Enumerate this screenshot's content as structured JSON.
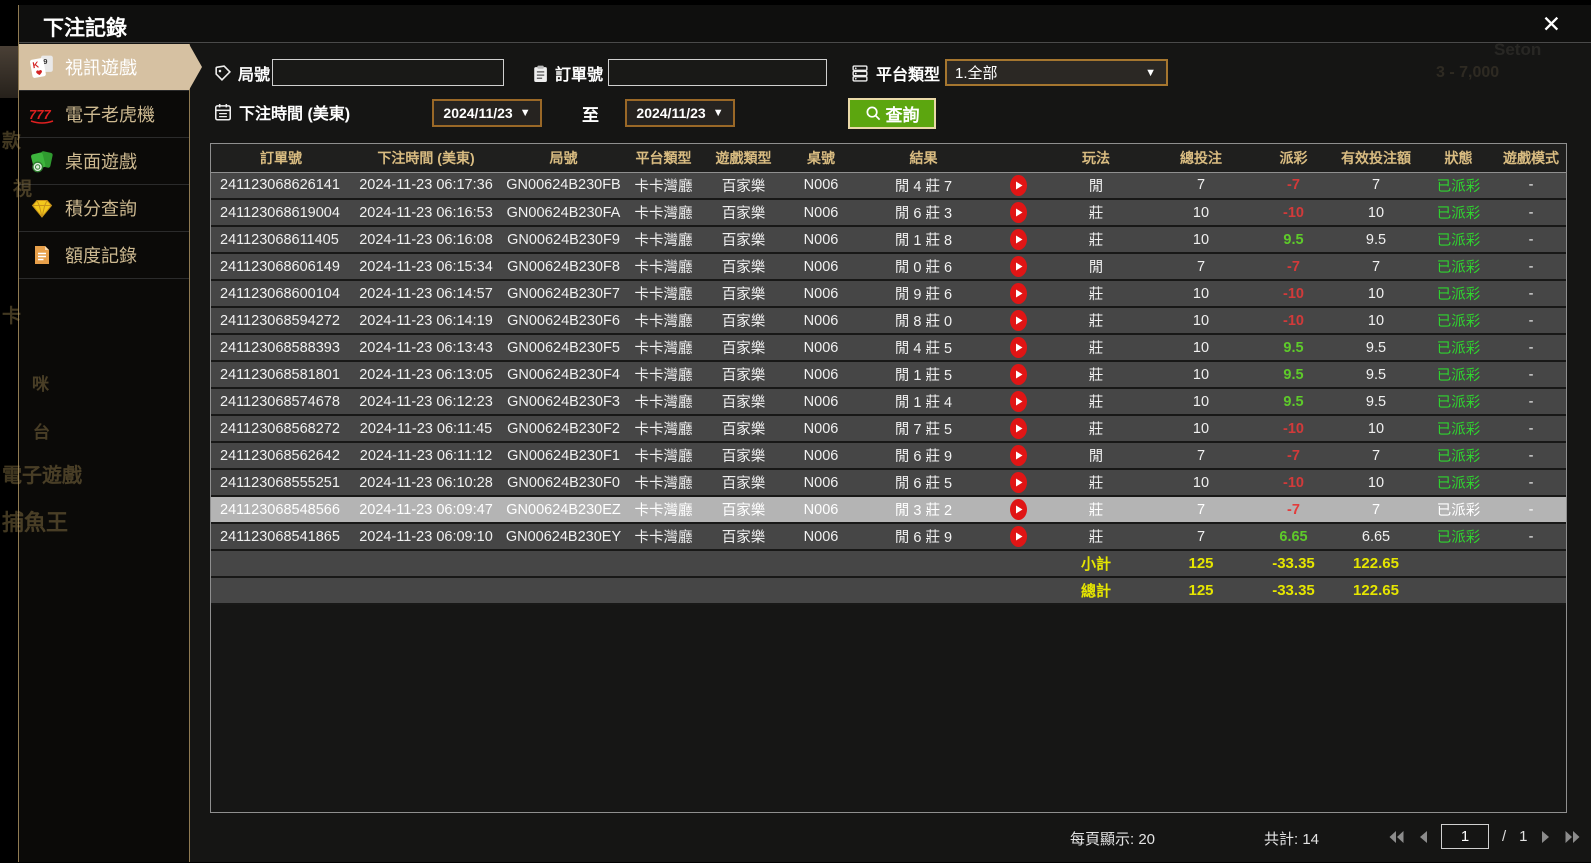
{
  "window": {
    "title": "下注記錄",
    "close_icon": "✕"
  },
  "background": {
    "fragments": {
      "f1": "款",
      "f2": "視",
      "f3": "卡",
      "f4": "咪",
      "f5": "台",
      "f6": "電子遊戲",
      "f7": "捕魚王",
      "f8": "Seton",
      "f9": "3 - 7,000"
    }
  },
  "sidebar": {
    "items": [
      {
        "label": "視訊遊戲",
        "icon": "playing-cards-icon",
        "active": true
      },
      {
        "label": "電子老虎機",
        "icon": "slot-777-icon",
        "active": false
      },
      {
        "label": "桌面遊戲",
        "icon": "table-games-icon",
        "active": false
      },
      {
        "label": "積分查詢",
        "icon": "diamond-icon",
        "active": false
      },
      {
        "label": "額度記錄",
        "icon": "document-icon",
        "active": false
      }
    ]
  },
  "filters": {
    "round_label": "局號",
    "round_value": "",
    "order_label": "訂單號",
    "order_value": "",
    "platform_label": "平台類型",
    "platform_value": "1.全部",
    "time_label": "下注時間 (美東)",
    "date_from": "2024/11/23",
    "range_to_label": "至",
    "date_to": "2024/11/23",
    "search_label": "查詢"
  },
  "table": {
    "headers": [
      "訂單號",
      "下注時間 (美東)",
      "局號",
      "平台類型",
      "遊戲類型",
      "桌號",
      "結果",
      "",
      "玩法",
      "總投注",
      "派彩",
      "有效投注額",
      "狀態",
      "遊戲模式"
    ],
    "rows": [
      {
        "order": "241123068626141",
        "time": "2024-11-23 06:17:36",
        "round": "GN00624B230FB",
        "platform": "卡卡灣廳",
        "game": "百家樂",
        "table_no": "N006",
        "result": "閒 4 莊 7",
        "play": "閒",
        "bet": "7",
        "payout": "-7",
        "valid": "7",
        "status": "已派彩",
        "mode": "-",
        "highlighted": false
      },
      {
        "order": "241123068619004",
        "time": "2024-11-23 06:16:53",
        "round": "GN00624B230FA",
        "platform": "卡卡灣廳",
        "game": "百家樂",
        "table_no": "N006",
        "result": "閒 6 莊 3",
        "play": "莊",
        "bet": "10",
        "payout": "-10",
        "valid": "10",
        "status": "已派彩",
        "mode": "-",
        "highlighted": false
      },
      {
        "order": "241123068611405",
        "time": "2024-11-23 06:16:08",
        "round": "GN00624B230F9",
        "platform": "卡卡灣廳",
        "game": "百家樂",
        "table_no": "N006",
        "result": "閒 1 莊 8",
        "play": "莊",
        "bet": "10",
        "payout": "9.5",
        "valid": "9.5",
        "status": "已派彩",
        "mode": "-",
        "highlighted": false
      },
      {
        "order": "241123068606149",
        "time": "2024-11-23 06:15:34",
        "round": "GN00624B230F8",
        "platform": "卡卡灣廳",
        "game": "百家樂",
        "table_no": "N006",
        "result": "閒 0 莊 6",
        "play": "閒",
        "bet": "7",
        "payout": "-7",
        "valid": "7",
        "status": "已派彩",
        "mode": "-",
        "highlighted": false
      },
      {
        "order": "241123068600104",
        "time": "2024-11-23 06:14:57",
        "round": "GN00624B230F7",
        "platform": "卡卡灣廳",
        "game": "百家樂",
        "table_no": "N006",
        "result": "閒 9 莊 6",
        "play": "莊",
        "bet": "10",
        "payout": "-10",
        "valid": "10",
        "status": "已派彩",
        "mode": "-",
        "highlighted": false
      },
      {
        "order": "241123068594272",
        "time": "2024-11-23 06:14:19",
        "round": "GN00624B230F6",
        "platform": "卡卡灣廳",
        "game": "百家樂",
        "table_no": "N006",
        "result": "閒 8 莊 0",
        "play": "莊",
        "bet": "10",
        "payout": "-10",
        "valid": "10",
        "status": "已派彩",
        "mode": "-",
        "highlighted": false
      },
      {
        "order": "241123068588393",
        "time": "2024-11-23 06:13:43",
        "round": "GN00624B230F5",
        "platform": "卡卡灣廳",
        "game": "百家樂",
        "table_no": "N006",
        "result": "閒 4 莊 5",
        "play": "莊",
        "bet": "10",
        "payout": "9.5",
        "valid": "9.5",
        "status": "已派彩",
        "mode": "-",
        "highlighted": false
      },
      {
        "order": "241123068581801",
        "time": "2024-11-23 06:13:05",
        "round": "GN00624B230F4",
        "platform": "卡卡灣廳",
        "game": "百家樂",
        "table_no": "N006",
        "result": "閒 1 莊 5",
        "play": "莊",
        "bet": "10",
        "payout": "9.5",
        "valid": "9.5",
        "status": "已派彩",
        "mode": "-",
        "highlighted": false
      },
      {
        "order": "241123068574678",
        "time": "2024-11-23 06:12:23",
        "round": "GN00624B230F3",
        "platform": "卡卡灣廳",
        "game": "百家樂",
        "table_no": "N006",
        "result": "閒 1 莊 4",
        "play": "莊",
        "bet": "10",
        "payout": "9.5",
        "valid": "9.5",
        "status": "已派彩",
        "mode": "-",
        "highlighted": false
      },
      {
        "order": "241123068568272",
        "time": "2024-11-23 06:11:45",
        "round": "GN00624B230F2",
        "platform": "卡卡灣廳",
        "game": "百家樂",
        "table_no": "N006",
        "result": "閒 7 莊 5",
        "play": "莊",
        "bet": "10",
        "payout": "-10",
        "valid": "10",
        "status": "已派彩",
        "mode": "-",
        "highlighted": false
      },
      {
        "order": "241123068562642",
        "time": "2024-11-23 06:11:12",
        "round": "GN00624B230F1",
        "platform": "卡卡灣廳",
        "game": "百家樂",
        "table_no": "N006",
        "result": "閒 6 莊 9",
        "play": "閒",
        "bet": "7",
        "payout": "-7",
        "valid": "7",
        "status": "已派彩",
        "mode": "-",
        "highlighted": false
      },
      {
        "order": "241123068555251",
        "time": "2024-11-23 06:10:28",
        "round": "GN00624B230F0",
        "platform": "卡卡灣廳",
        "game": "百家樂",
        "table_no": "N006",
        "result": "閒 6 莊 5",
        "play": "莊",
        "bet": "10",
        "payout": "-10",
        "valid": "10",
        "status": "已派彩",
        "mode": "-",
        "highlighted": false
      },
      {
        "order": "241123068548566",
        "time": "2024-11-23 06:09:47",
        "round": "GN00624B230EZ",
        "platform": "卡卡灣廳",
        "game": "百家樂",
        "table_no": "N006",
        "result": "閒 3 莊 2",
        "play": "莊",
        "bet": "7",
        "payout": "-7",
        "valid": "7",
        "status": "已派彩",
        "mode": "-",
        "highlighted": true
      },
      {
        "order": "241123068541865",
        "time": "2024-11-23 06:09:10",
        "round": "GN00624B230EY",
        "platform": "卡卡灣廳",
        "game": "百家樂",
        "table_no": "N006",
        "result": "閒 6 莊 9",
        "play": "莊",
        "bet": "7",
        "payout": "6.65",
        "valid": "6.65",
        "status": "已派彩",
        "mode": "-",
        "highlighted": false
      }
    ],
    "summary": [
      {
        "label": "小計",
        "bet": "125",
        "payout": "-33.35",
        "valid": "122.65"
      },
      {
        "label": "總計",
        "bet": "125",
        "payout": "-33.35",
        "valid": "122.65"
      }
    ]
  },
  "pagination": {
    "per_page_label": "每頁顯示: 20",
    "total_label": "共計: 14",
    "current_page": "1",
    "separator": "/",
    "total_pages": "1"
  }
}
